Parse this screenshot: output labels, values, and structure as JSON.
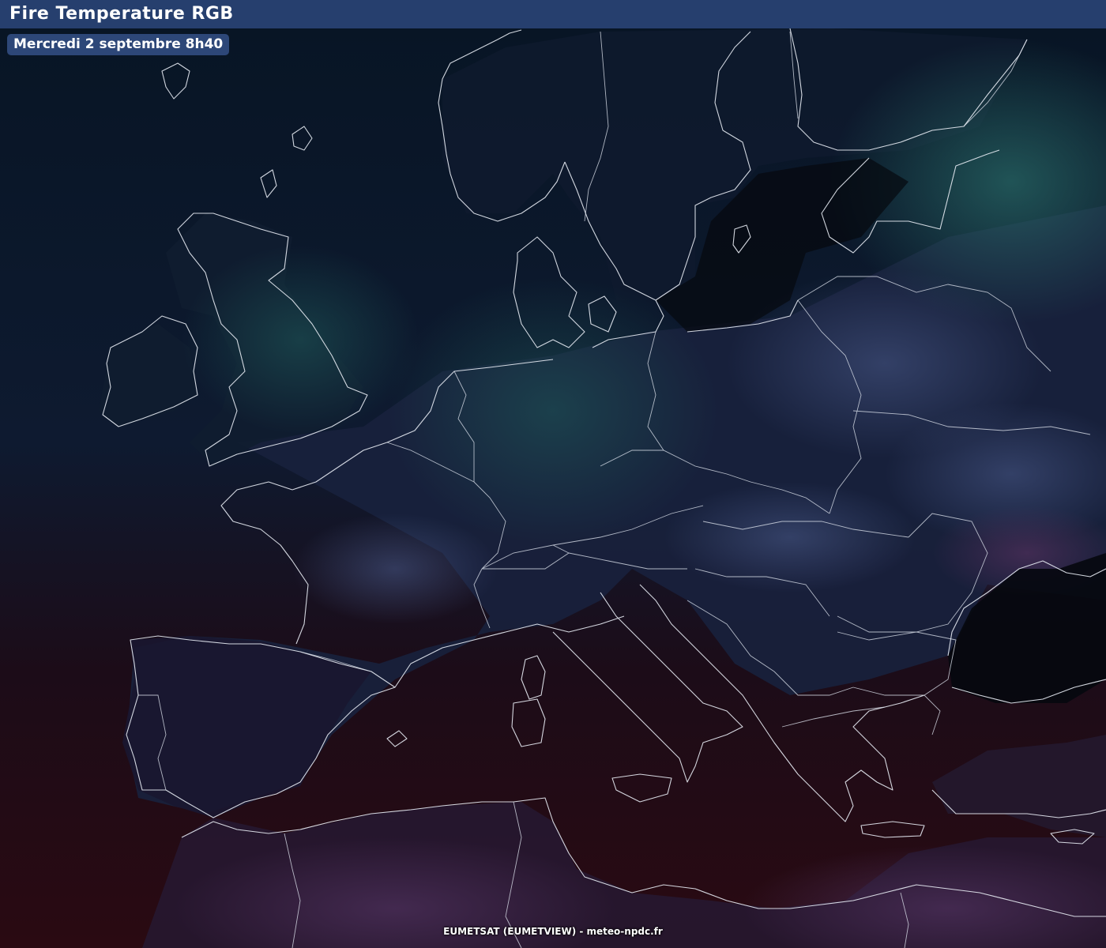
{
  "header": {
    "title": "Fire Temperature RGB",
    "date_label": "Mercredi 2 septembre 8h40"
  },
  "map": {
    "product": "Fire Temperature RGB",
    "region": "Europe",
    "colors": {
      "ocean_north": "#06101c",
      "cloud_cyan": "#1e5a66",
      "land_europe": "#1a2440",
      "mediterranean": "#2a0810",
      "north_africa": "#2c1a3a",
      "coastline": "#e8ecf4",
      "header_bg": "#263f6e"
    }
  },
  "footer": {
    "credit": "EUMETSAT (EUMETVIEW) - meteo-npdc.fr"
  }
}
